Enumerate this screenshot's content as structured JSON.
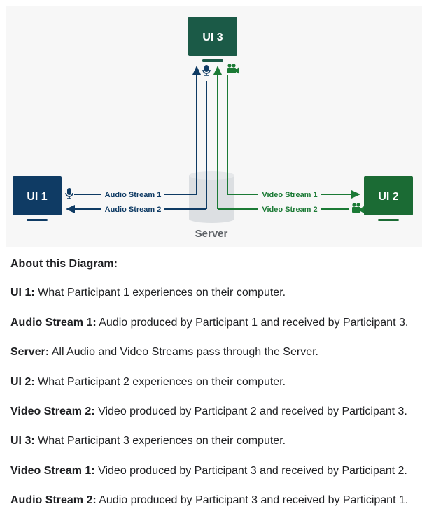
{
  "colors": {
    "ui1": "#0f3b64",
    "ui2": "#1b6b34",
    "ui3": "#1b5a47",
    "blue_stream": "#0f3b64",
    "green_stream": "#1b7a35",
    "server": "#dcdfe2",
    "panel_bg": "#f7f7f7"
  },
  "diagram": {
    "ui1": "UI 1",
    "ui2": "UI 2",
    "ui3": "UI 3",
    "server": "Server",
    "audio_stream_1": "Audio Stream 1",
    "audio_stream_2": "Audio Stream 2",
    "video_stream_1": "Video Stream 1",
    "video_stream_2": "Video Stream 2",
    "icons": [
      "microphone-icon",
      "video-camera-icon"
    ]
  },
  "about": {
    "heading": "About this Diagram:",
    "items": [
      {
        "term": "UI 1:",
        "text": " What Participant 1 experiences on their computer."
      },
      {
        "term": "Audio Stream 1:",
        "text": " Audio produced by Participant 1 and received by Participant 3."
      },
      {
        "term": "Server:",
        "text": " All Audio and Video Streams pass through the Server."
      },
      {
        "term": "UI 2:",
        "text": " What Participant 2 experiences on their computer."
      },
      {
        "term": "Video Stream 2:",
        "text": " Video produced by Participant 2 and received by Participant 3."
      },
      {
        "term": "UI 3:",
        "text": " What Participant 3 experiences on their computer."
      },
      {
        "term": "Video Stream 1:",
        "text": " Video produced by Participant 3 and received by Participant 2."
      },
      {
        "term": "Audio Stream 2:",
        "text": " Audio produced by Participant 3 and received by Participant 1."
      }
    ]
  }
}
